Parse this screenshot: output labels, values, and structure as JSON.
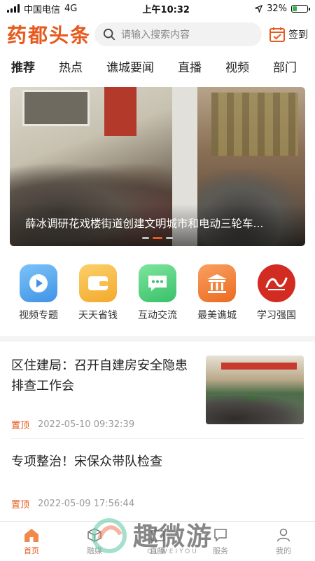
{
  "status_bar": {
    "carrier": "中国电信",
    "network": "4G",
    "time": "上午10:32",
    "battery": "32%",
    "battery_level_pct": 32
  },
  "header": {
    "logo": "药都头条",
    "search_placeholder": "请输入搜索内容",
    "signin_label": "签到"
  },
  "tabs": [
    {
      "label": "推荐",
      "active": true
    },
    {
      "label": "热点",
      "active": false
    },
    {
      "label": "谯城要闻",
      "active": false
    },
    {
      "label": "直播",
      "active": false
    },
    {
      "label": "视频",
      "active": false
    },
    {
      "label": "部门",
      "active": false
    }
  ],
  "banner": {
    "caption": "薛冰调研花戏楼街道创建文明城市和电动三轮车...",
    "slides_total": 3,
    "slide_active": 2
  },
  "quick_links": [
    {
      "label": "视频专题",
      "icon": "play-video-icon",
      "color": "#4aa3ea"
    },
    {
      "label": "天天省钱",
      "icon": "wallet-icon",
      "color": "#f6b33b"
    },
    {
      "label": "互动交流",
      "icon": "chat-bubble-icon",
      "color": "#4ccf7c"
    },
    {
      "label": "最美谯城",
      "icon": "temple-icon",
      "color": "#f0782b"
    },
    {
      "label": "学习强国",
      "icon": "xuexi-logo-icon",
      "color": "#d22b22"
    }
  ],
  "news": [
    {
      "title": "区住建局：召开自建房安全隐患排查工作会",
      "tag": "置顶",
      "date": "2022-05-10 09:32:39",
      "has_thumb": true
    },
    {
      "title": "专项整治！宋保众带队检查",
      "tag": "置顶",
      "date": "2022-05-09 17:56:44",
      "has_thumb": false
    }
  ],
  "tabbar": [
    {
      "label": "首页",
      "icon": "home-icon",
      "active": true
    },
    {
      "label": "融媒",
      "icon": "cube-icon",
      "active": false
    },
    {
      "label": "直播",
      "icon": "live-icon",
      "active": false
    },
    {
      "label": "服务",
      "icon": "service-icon",
      "active": false
    },
    {
      "label": "我的",
      "icon": "user-icon",
      "active": false
    }
  ],
  "watermark": {
    "text": "趣微游",
    "sub": "QUWEIYOU"
  },
  "colors": {
    "accent": "#e65a1e"
  }
}
